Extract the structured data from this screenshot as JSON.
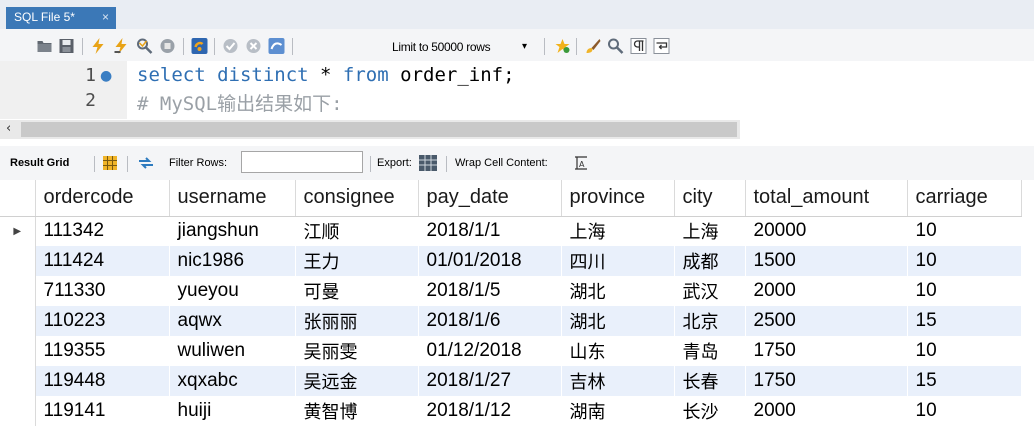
{
  "tab": {
    "title": "SQL File 5*",
    "close": "×"
  },
  "toolbar": {
    "icons": [
      "open-folder-icon",
      "save-icon",
      "execute-lightning-icon",
      "execute-cursor-lightning-icon",
      "explain-magnifier-icon",
      "stop-icon",
      "toggle-autocommit-icon",
      "commit-icon",
      "rollback-icon",
      "save-snippet-icon",
      "beautify-icon",
      "find-icon",
      "invisible-chars-icon",
      "word-wrap-icon"
    ],
    "limit_label": "Limit to 50000 rows",
    "limit_arrow": "▾"
  },
  "editor": {
    "lines": [
      {
        "num": "1",
        "marker": "●",
        "kw1": "select distinct",
        "mid": " * ",
        "kw2": "from",
        "rest": " order_inf;"
      },
      {
        "num": "2",
        "comment": "# MySQL输出结果如下:"
      }
    ]
  },
  "scroll": {
    "left_arrow": "‹"
  },
  "result_toolbar": {
    "result_grid": "Result Grid",
    "filter_rows": "Filter Rows:",
    "export": "Export:",
    "wrap": "Wrap Cell Content:"
  },
  "grid": {
    "columns": [
      "ordercode",
      "username",
      "consignee",
      "pay_date",
      "province",
      "city",
      "total_amount",
      "carriage"
    ],
    "rows": [
      [
        "111342",
        "jiangshun",
        "江顺",
        "2018/1/1",
        "上海",
        "上海",
        "20000",
        "10"
      ],
      [
        "111424",
        "nic1986",
        "王力",
        "01/01/2018",
        "四川",
        "成都",
        "1500",
        "10"
      ],
      [
        "711330",
        "yueyou",
        "可曼",
        "2018/1/5",
        "湖北",
        "武汉",
        "2000",
        "10"
      ],
      [
        "110223",
        "aqwx",
        "张丽丽",
        "2018/1/6",
        "湖北",
        "北京",
        "2500",
        "15"
      ],
      [
        "119355",
        "wuliwen",
        "吴丽雯",
        "01/12/2018",
        "山东",
        "青岛",
        "1750",
        "10"
      ],
      [
        "119448",
        "xqxabc",
        "吴远金",
        "2018/1/27",
        "吉林",
        "长春",
        "1750",
        "15"
      ],
      [
        "119141",
        "huiji",
        "黄智博",
        "2018/1/12",
        "湖南",
        "长沙",
        "2000",
        "10"
      ]
    ],
    "current_row_marker": "▶"
  },
  "colors": {
    "tab_active": "#3b78b7",
    "keyword": "#2f6fb3",
    "row_alt": "#e9f0fb"
  }
}
